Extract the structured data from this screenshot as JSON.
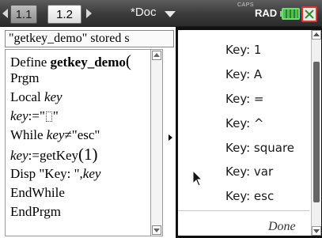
{
  "titlebar": {
    "tabs": [
      "1.1",
      "1.2"
    ],
    "doc_title": "*Doc",
    "caps": "CAPS",
    "mode": "RAD"
  },
  "editor": {
    "status": "\"getkey_demo\" stored s",
    "lines": {
      "define_kw": "Define",
      "define_name": "getkey_demo",
      "define_paren": "(",
      "prgm": "Prgm",
      "local_kw": "Local",
      "local_var": "key",
      "assign1_var": "key",
      "assign1_op": ":=\"",
      "assign1_end": "\"",
      "while_kw": "While",
      "while_var": "key",
      "while_cond": "≠\"esc\"",
      "assign2_var": "key",
      "assign2_op": ":=getKey",
      "assign2_arg": "(1)",
      "disp_text": "Disp \"Key: \",",
      "disp_var": "key",
      "endwhile": "EndWhile",
      "endprgm": "EndPrgm"
    }
  },
  "output": {
    "lines": [
      "Key: 1",
      "Key: A",
      "Key: =",
      "Key: ^",
      "Key: square",
      "Key: var",
      "Key: esc"
    ],
    "done_label": "Done"
  },
  "colors": {
    "titlebar_bg": "#3a3a3a",
    "battery": "#4fbf4f",
    "close_border": "#dd3333"
  }
}
